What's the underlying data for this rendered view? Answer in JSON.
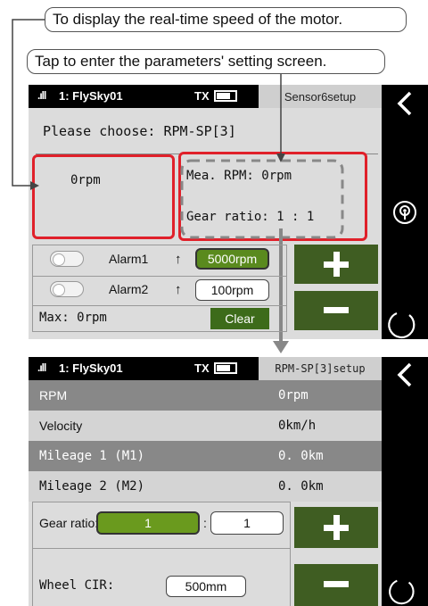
{
  "callouts": {
    "speed": "To display the real-time speed of the motor.",
    "tap": "Tap to enter the parameters' setting screen."
  },
  "screen1": {
    "status_model": "1: FlySky01",
    "status_tx": "TX",
    "status_title": "Sensor6setup",
    "choose_text": "Please choose: RPM-SP[3]",
    "rpm_value": "0rpm",
    "mea_rpm": "Mea. RPM: 0rpm",
    "gear_ratio": "Gear ratio: 1 : 1",
    "alarm1_label": "Alarm1",
    "alarm1_value": "5000rpm",
    "alarm2_label": "Alarm2",
    "alarm2_value": "100rpm",
    "max_label": "Max: 0rpm",
    "clear_label": "Clear"
  },
  "screen2": {
    "status_model": "1: FlySky01",
    "status_tx": "TX",
    "status_title": "RPM-SP[3]setup",
    "rows": [
      {
        "label": "RPM",
        "value": "0rpm"
      },
      {
        "label": "Velocity",
        "value": "0km/h"
      },
      {
        "label": "Mileage 1 (M1)",
        "value": "0. 0km"
      },
      {
        "label": "Mileage 2 (M2)",
        "value": "0. 0km"
      }
    ],
    "gear_label": "Gear ratio:",
    "gear_a": "1",
    "gear_sep": ":",
    "gear_b": "1",
    "wheel_label": "Wheel CIR:",
    "wheel_value": "500mm"
  },
  "colors": {
    "accent_green": "#5a8a1e",
    "button_green": "#3f5d22",
    "highlight_red": "#e0202a"
  }
}
